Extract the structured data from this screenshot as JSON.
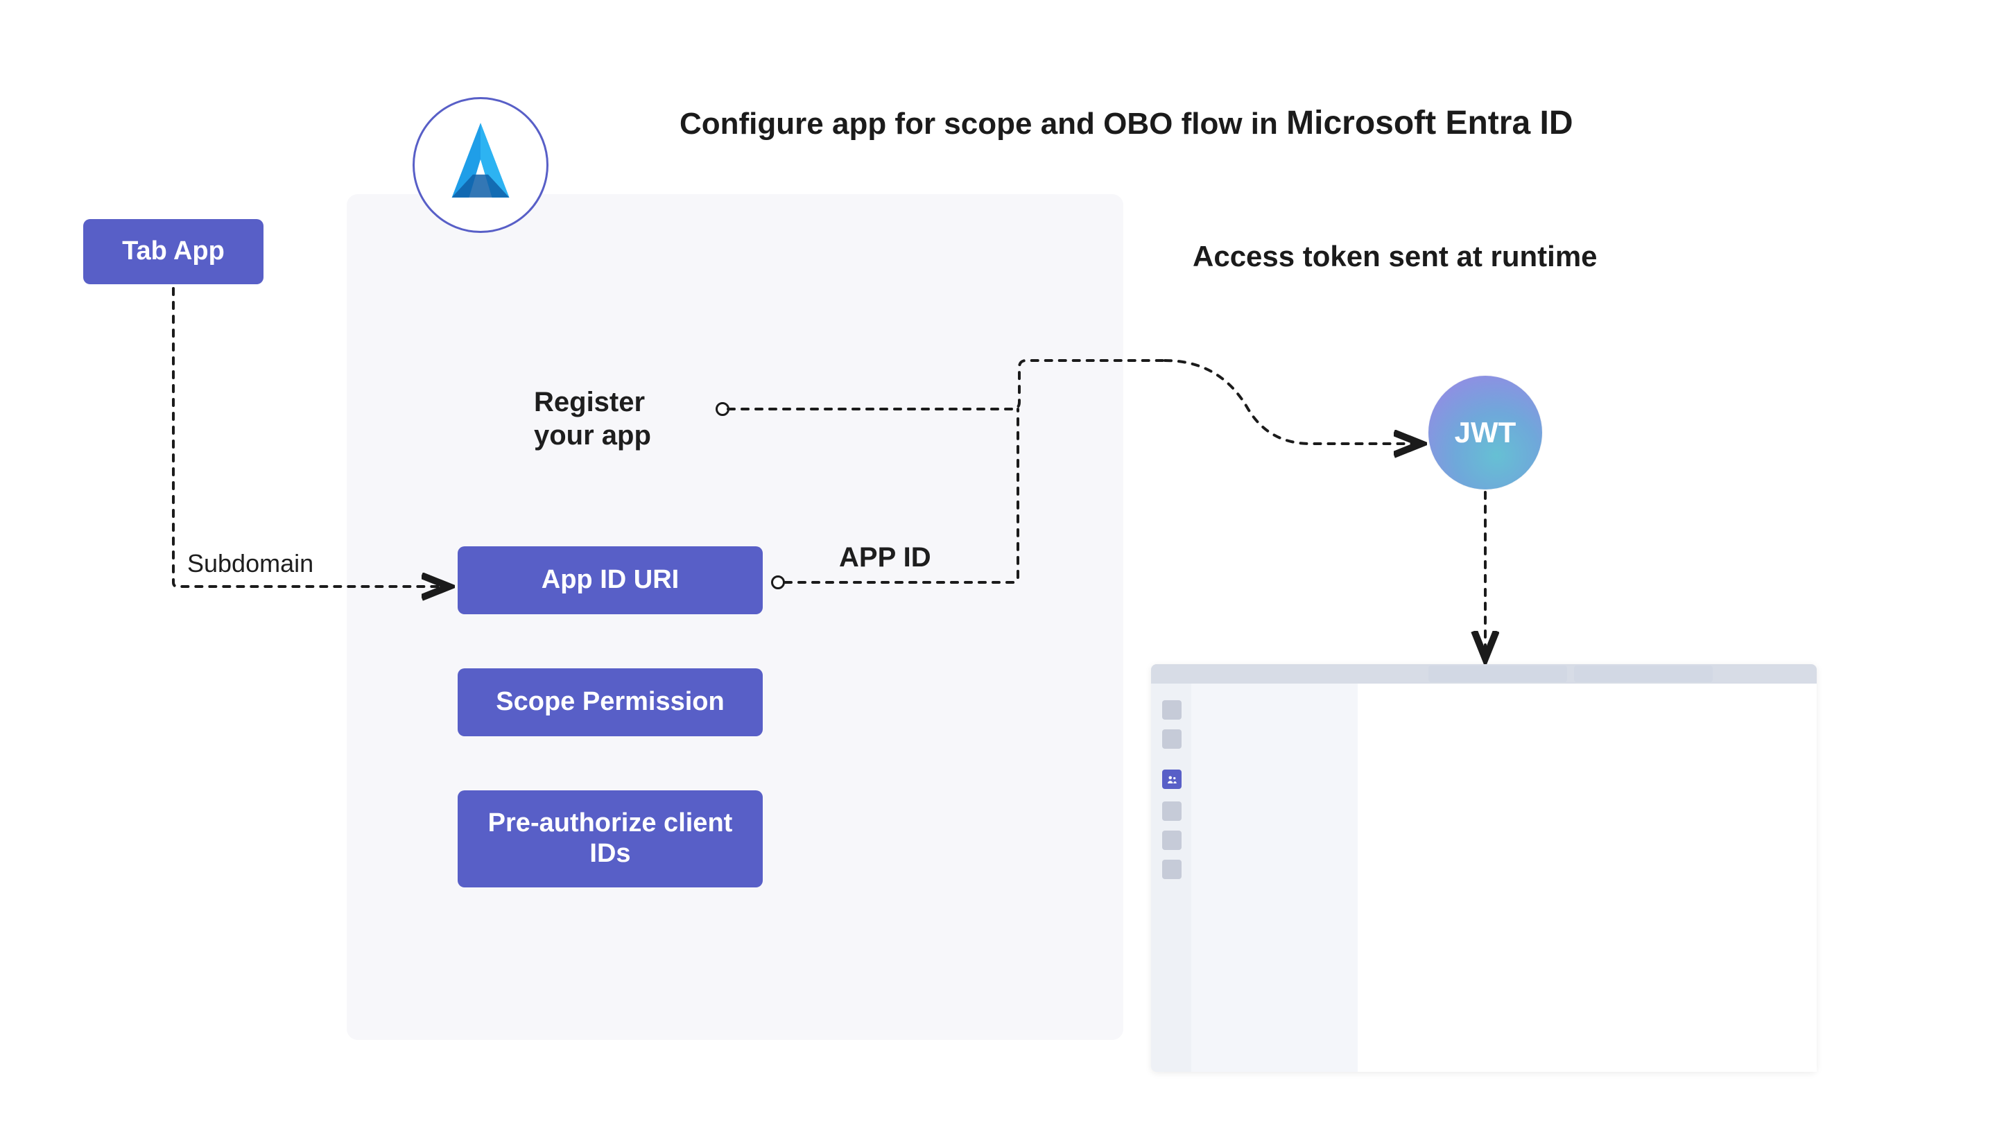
{
  "title": {
    "line1": "Configure app for scope and OBO flow in ",
    "strong": "Microsoft Entra ID"
  },
  "subtitle": "Access token sent at runtime",
  "nodes": {
    "tab_app": "Tab App",
    "app_id_uri": "App ID URI",
    "scope_permission": "Scope Permission",
    "pre_authorize": "Pre-authorize client IDs"
  },
  "labels": {
    "register_line1": "Register",
    "register_line2": "your app",
    "subdomain": "Subdomain",
    "app_id": "APP ID"
  },
  "jwt": "JWT",
  "colors": {
    "node_bg": "#585fc7",
    "panel_bg": "#f7f7fa",
    "dash": "#1b1b1b"
  }
}
